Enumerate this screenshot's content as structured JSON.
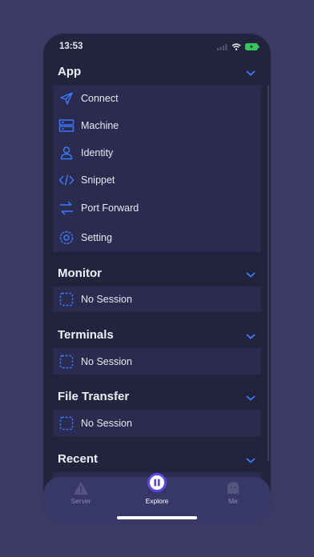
{
  "status_bar": {
    "time": "13:53"
  },
  "sections": {
    "app": {
      "title": "App",
      "items": [
        {
          "label": "Connect",
          "icon": "send-icon"
        },
        {
          "label": "Machine",
          "icon": "server-icon"
        },
        {
          "label": "Identity",
          "icon": "person-icon"
        },
        {
          "label": "Snippet",
          "icon": "code-icon"
        },
        {
          "label": "Port Forward",
          "icon": "arrows-icon"
        },
        {
          "label": "Setting",
          "icon": "gear-icon"
        }
      ]
    },
    "monitor": {
      "title": "Monitor",
      "empty_label": "No Session"
    },
    "terminals": {
      "title": "Terminals",
      "empty_label": "No Session"
    },
    "file_transfer": {
      "title": "File Transfer",
      "empty_label": "No Session"
    },
    "recent": {
      "title": "Recent"
    }
  },
  "tabbar": {
    "tabs": [
      {
        "label": "Server",
        "icon": "warning-icon"
      },
      {
        "label": "Explore",
        "icon": "explore-icon"
      },
      {
        "label": "Me",
        "icon": "ghost-icon"
      }
    ]
  },
  "colors": {
    "accent": "#3d7bff",
    "background": "#23233d",
    "card": "#2b2b50",
    "tabbar": "#383868"
  }
}
